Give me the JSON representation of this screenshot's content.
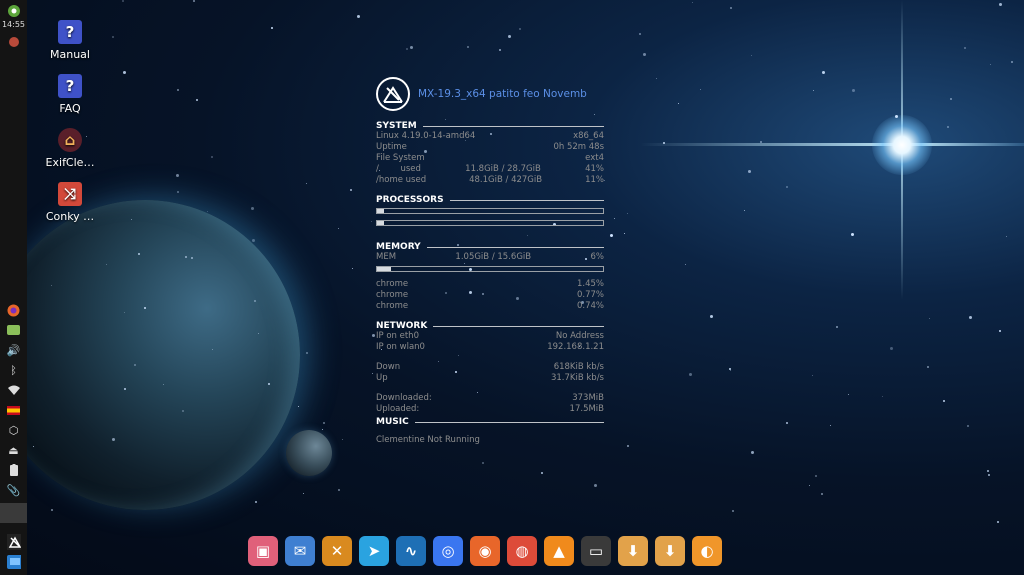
{
  "panel": {
    "time": "14:55"
  },
  "desktop": [
    {
      "label": "Manual",
      "icon": "help-icon"
    },
    {
      "label": "FAQ",
      "icon": "help-icon"
    },
    {
      "label": "ExifCle…",
      "icon": "exifcleaner-icon"
    },
    {
      "label": "Conky …",
      "icon": "conky-manager-icon"
    }
  ],
  "conky": {
    "title": "MX-19.3_x64 patito feo Novemb",
    "system": {
      "heading": "SYSTEM",
      "kernel": "Linux 4.19.0-14-amd64",
      "arch": "x86_64",
      "uptime_label": "Uptime",
      "uptime": "0h 52m 48s",
      "fs_label": "File System",
      "fs": "ext4",
      "root_label": "/        used",
      "root_usage": "11.8GiB / 28.7GiB",
      "root_pct": "41%",
      "home_label": "/home used",
      "home_usage": "48.1GiB / 427GiB",
      "home_pct": "11%"
    },
    "processors": {
      "heading": "PROCESSORS",
      "cpu1": 0.03,
      "cpu2": 0.03
    },
    "memory": {
      "heading": "MEMORY",
      "mem_label": "MEM",
      "mem_usage": "1.05GiB / 15.6GiB",
      "mem_pct": "6%",
      "mem_fraction": 0.06,
      "procs": [
        {
          "name": "chrome",
          "pct": "1.45%"
        },
        {
          "name": "chrome",
          "pct": "0.77%"
        },
        {
          "name": "chrome",
          "pct": "0.74%"
        }
      ]
    },
    "network": {
      "heading": "NETWORK",
      "eth_label": "IP on eth0",
      "eth": "No Address",
      "wlan_label": "IP on wlan0",
      "wlan": "192.168.1.21",
      "down_label": "Down",
      "down": "618KiB kb/s",
      "up_label": "Up",
      "up": "31.7KiB kb/s",
      "downloaded_label": "Downloaded:",
      "downloaded": "373MiB",
      "uploaded_label": "Uploaded:",
      "uploaded": "17.5MiB"
    },
    "music": {
      "heading": "MUSIC",
      "status": "Clementine Not Running"
    }
  },
  "dock": [
    {
      "name": "gallery-icon",
      "color": "#e0607a"
    },
    {
      "name": "thunderbird-icon",
      "color": "#3f7fd1"
    },
    {
      "name": "xfce-app-icon",
      "color": "#d98a1f"
    },
    {
      "name": "telegram-icon",
      "color": "#2aa3e0"
    },
    {
      "name": "system-monitor-icon",
      "color": "#1e6fb5"
    },
    {
      "name": "signal-icon",
      "color": "#3a76f0"
    },
    {
      "name": "firefox-icon",
      "color": "#e8662a"
    },
    {
      "name": "chrome-icon",
      "color": "#dd4b39"
    },
    {
      "name": "vlc-icon",
      "color": "#f08a1c"
    },
    {
      "name": "terminal-icon",
      "color": "#3a3a3a"
    },
    {
      "name": "package-installer-icon",
      "color": "#e2a24a"
    },
    {
      "name": "download-icon",
      "color": "#e2a24a"
    },
    {
      "name": "clementine-icon",
      "color": "#f0962a"
    }
  ]
}
